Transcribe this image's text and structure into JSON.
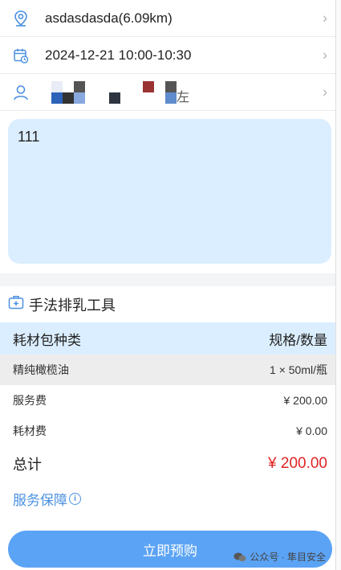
{
  "info": {
    "address": "asdasdasda(6.09km)",
    "datetime": "2024-12-21 10:00-10:30",
    "contact_partial": "左"
  },
  "note": {
    "text": "111"
  },
  "tools": {
    "title": "手法排乳工具",
    "table": {
      "col_type": "耗材包种类",
      "col_spec": "规格/数量",
      "rows": [
        {
          "name": "精纯橄榄油",
          "spec": "1 × 50ml/瓶"
        }
      ]
    },
    "fees": [
      {
        "label": "服务费",
        "value": "¥ 200.00"
      },
      {
        "label": "耗材费",
        "value": "¥ 0.00"
      }
    ],
    "total_label": "总计",
    "total_value": "¥ 200.00",
    "guarantee": "服务保障",
    "info_mark": "i"
  },
  "footer": {
    "button": "立即预购",
    "watermark": "公众号 · 隼目安全"
  },
  "colors": {
    "accent": "#5ba3f5",
    "note_bg": "#dbeeff",
    "price_red": "#e02424",
    "link_blue": "#4a90e2"
  }
}
